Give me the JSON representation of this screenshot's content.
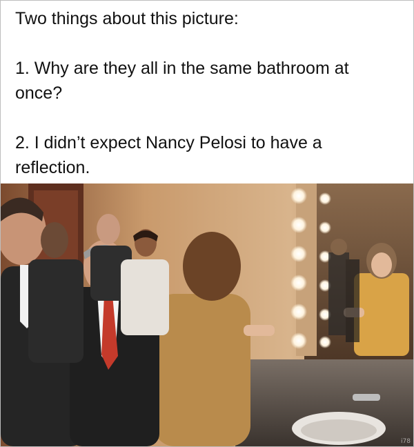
{
  "caption": {
    "heading": "Two things about this picture:",
    "point_1_line_1": "1. Why are they all in the same bathroom at",
    "point_1_line_2": "once?",
    "point_2_line_1": "2. I didn’t expect Nancy Pelosi to have a",
    "point_2_line_2": "reflection."
  },
  "photo": {
    "subject": "people-in-bathroom-with-mirror",
    "watermark": "i78"
  },
  "colors": {
    "wall": "#c9a27a",
    "mirror_glow": "#f5e2c4",
    "counter": "#5a5048",
    "yellow_dress": "#d9a347"
  }
}
